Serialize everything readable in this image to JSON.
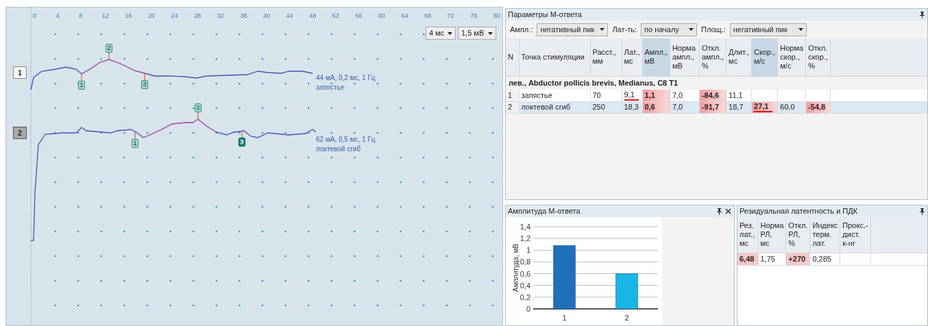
{
  "emg_view": {
    "time_ticks": [
      "0",
      "4",
      "8",
      "12",
      "16",
      "20",
      "24",
      "28",
      "32",
      "36",
      "40",
      "44",
      "48",
      "52",
      "56",
      "60",
      "64",
      "68",
      "72",
      "76",
      "80"
    ],
    "scale_dropdowns": [
      {
        "value": "4 мс"
      },
      {
        "value": "1,5 мВ"
      }
    ],
    "channels": [
      {
        "label": "1",
        "selected": false,
        "annotation_lines": [
          "44 мА, 0,2 мс, 1 Гц",
          "запястье"
        ],
        "markers": [
          {
            "label": "1",
            "selected": false
          },
          {
            "label": "2",
            "selected": false
          },
          {
            "label": "3",
            "selected": false
          }
        ]
      },
      {
        "label": "2",
        "selected": true,
        "annotation_lines": [
          "62 мА, 0,5 мс, 1 Гц",
          "локтевой сгиб"
        ],
        "markers": [
          {
            "label": "1",
            "selected": false
          },
          {
            "label": "2",
            "selected": false
          },
          {
            "label": "3",
            "selected": true
          }
        ]
      }
    ]
  },
  "m_response_panel": {
    "title": "Параметры М-ответа",
    "filters": [
      {
        "label": "Ампл.:",
        "value": "негативный пик"
      },
      {
        "label": "Лат-ть:",
        "value": "по началу"
      },
      {
        "label": "Площ.:",
        "value": "негативный пик"
      }
    ],
    "table": {
      "columns": [
        {
          "label": "N",
          "highlighted": false
        },
        {
          "label": "Точка стимуляции",
          "highlighted": false
        },
        {
          "label": "Расст.,\nмм",
          "highlighted": false
        },
        {
          "label": "Лат.,\nмс",
          "highlighted": false
        },
        {
          "label": "Ампл.,\nмВ",
          "highlighted": true
        },
        {
          "label": "Норма\nампл.,\nмВ",
          "highlighted": false
        },
        {
          "label": "Откл.\nампл.,\n%",
          "highlighted": false
        },
        {
          "label": "Длит.,\nмс",
          "highlighted": false
        },
        {
          "label": "Скор.,\nм/с",
          "highlighted": true
        },
        {
          "label": "Норма\nскор.,\nм/с",
          "highlighted": false
        },
        {
          "label": "Откл.\nскор.,\n%",
          "highlighted": false
        }
      ],
      "group_row": "лев., Abductor pollicis brevis, Medianus, C8 T1",
      "rows": [
        {
          "selected": false,
          "cells": [
            {
              "text": "1",
              "alert": false,
              "underlined": false
            },
            {
              "text": "запястье",
              "alert": false,
              "underlined": false
            },
            {
              "text": "70",
              "alert": false,
              "underlined": false
            },
            {
              "text": "9,1",
              "alert": false,
              "underlined": true
            },
            {
              "text": "1,1",
              "alert": true,
              "underlined": false
            },
            {
              "text": "7,0",
              "alert": false,
              "underlined": false
            },
            {
              "text": "-84,6",
              "alert": true,
              "underlined": false
            },
            {
              "text": "11,1",
              "alert": false,
              "underlined": false
            },
            null,
            null,
            null
          ]
        },
        {
          "selected": true,
          "cells": [
            {
              "text": "2",
              "alert": false,
              "underlined": false
            },
            {
              "text": "локтевой сгиб",
              "alert": false,
              "underlined": false
            },
            {
              "text": "250",
              "alert": false,
              "underlined": false
            },
            {
              "text": "18,3",
              "alert": false,
              "underlined": false
            },
            {
              "text": "0,6",
              "alert": true,
              "underlined": false
            },
            {
              "text": "7,0",
              "alert": false,
              "underlined": false
            },
            {
              "text": "-91,7",
              "alert": true,
              "underlined": false
            },
            {
              "text": "18,7",
              "alert": false,
              "underlined": false
            },
            {
              "text": "27,1",
              "alert": true,
              "underlined": true
            },
            {
              "text": "60,0",
              "alert": false,
              "underlined": false
            },
            {
              "text": "-54,8",
              "alert": true,
              "underlined": false
            }
          ]
        }
      ]
    }
  },
  "amplitude_panel": {
    "title": "Амплитуда М-ответа",
    "chart_data": {
      "type": "bar",
      "grid": true,
      "ylabel": "Амплитуда, мВ",
      "categories": [
        "1",
        "2"
      ],
      "ylim": [
        0,
        1.4
      ],
      "yticks": [
        {
          "value": 0,
          "label": "0"
        },
        {
          "value": 0.2,
          "label": "0,2"
        },
        {
          "value": 0.4,
          "label": "0,4"
        },
        {
          "value": 0.6,
          "label": "0,6"
        },
        {
          "value": 0.8,
          "label": "0,8"
        },
        {
          "value": 1,
          "label": "1"
        },
        {
          "value": 1.2,
          "label": "1,2"
        },
        {
          "value": 1.4,
          "label": "1,4"
        }
      ],
      "series": [
        {
          "color": "#1f70b8",
          "values": [
            1.08,
            null
          ]
        },
        {
          "color": "#17b6e6",
          "values": [
            null,
            0.6
          ]
        }
      ]
    }
  },
  "residual_panel": {
    "title": "Резидуальная латентность и ПДК",
    "table": {
      "columns": [
        {
          "label": "Рез.\nлат.,\nмс"
        },
        {
          "label": "Норма\nРЛ,\nмс"
        },
        {
          "label": "Откл.\nРЛ,\n%"
        },
        {
          "label": "Индекс\nтерм.\nлат."
        },
        {
          "label": "Прокс.-\nдист.\nк-нг"
        }
      ],
      "rows": [
        {
          "cells": [
            {
              "text": "6,48",
              "alert": true
            },
            {
              "text": "1,75",
              "alert": false
            },
            {
              "text": "+270",
              "alert": true
            },
            {
              "text": "0,285",
              "alert": false
            },
            null
          ]
        }
      ]
    }
  }
}
